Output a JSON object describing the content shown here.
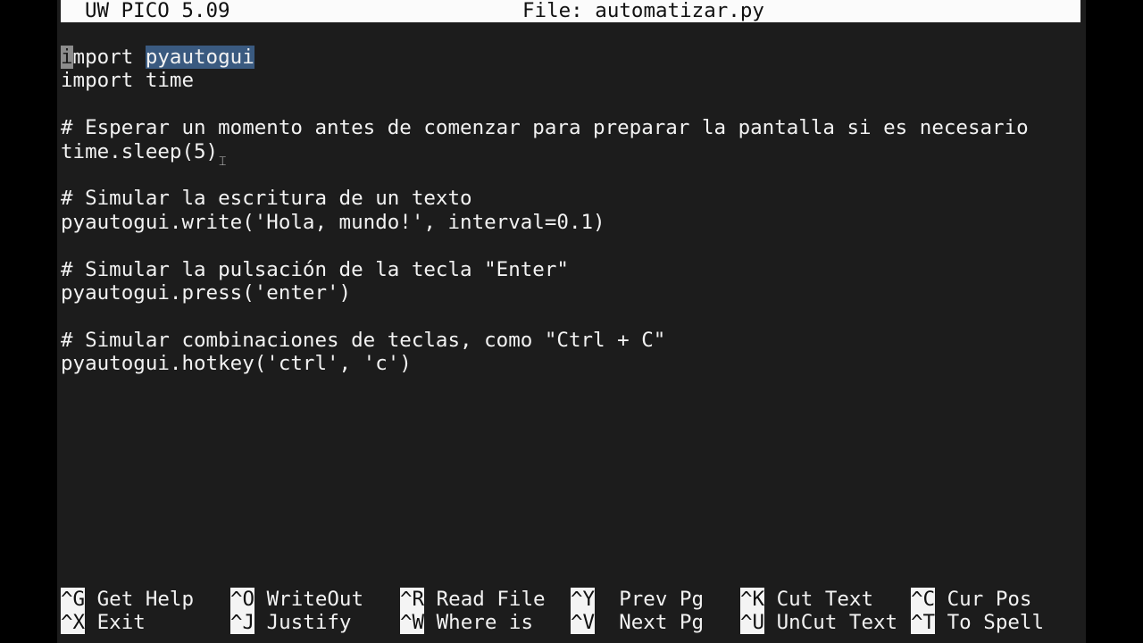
{
  "titlebar": {
    "app_name": "UW PICO 5.09",
    "file_label": "File: automatizar.py"
  },
  "editor": {
    "cursor_char": "i",
    "line1_rest": "mport ",
    "line1_selected": "pyautogui",
    "lines": [
      "import time",
      "",
      "# Esperar un momento antes de comenzar para preparar la pantalla si es necesario",
      "time.sleep(5)",
      "",
      "# Simular la escritura de un texto",
      "pyautogui.write('Hola, mundo!', interval=0.1)",
      "",
      "# Simular la pulsación de la tecla \"Enter\"",
      "pyautogui.press('enter')",
      "",
      "# Simular combinaciones de teclas, como \"Ctrl + C\"",
      "pyautogui.hotkey('ctrl', 'c')"
    ],
    "mouse_cursor_icon": "I-beam-cursor"
  },
  "shortcuts": [
    {
      "key": "^G",
      "label": "Get Help"
    },
    {
      "key": "^X",
      "label": "Exit"
    },
    {
      "key": "^O",
      "label": "WriteOut"
    },
    {
      "key": "^J",
      "label": "Justify"
    },
    {
      "key": "^R",
      "label": "Read File"
    },
    {
      "key": "^W",
      "label": "Where is"
    },
    {
      "key": "^Y",
      "label": "Prev Pg"
    },
    {
      "key": "^V",
      "label": "Next Pg"
    },
    {
      "key": "^K",
      "label": "Cut Text"
    },
    {
      "key": "^U",
      "label": "UnCut Text"
    },
    {
      "key": "^C",
      "label": "Cur Pos"
    },
    {
      "key": "^T",
      "label": "To Spell"
    }
  ],
  "colors": {
    "background": "#1c1c1c",
    "titlebar_bg": "#fbfbfb",
    "selection": "#3a5a80",
    "text": "#f2f2f2"
  }
}
